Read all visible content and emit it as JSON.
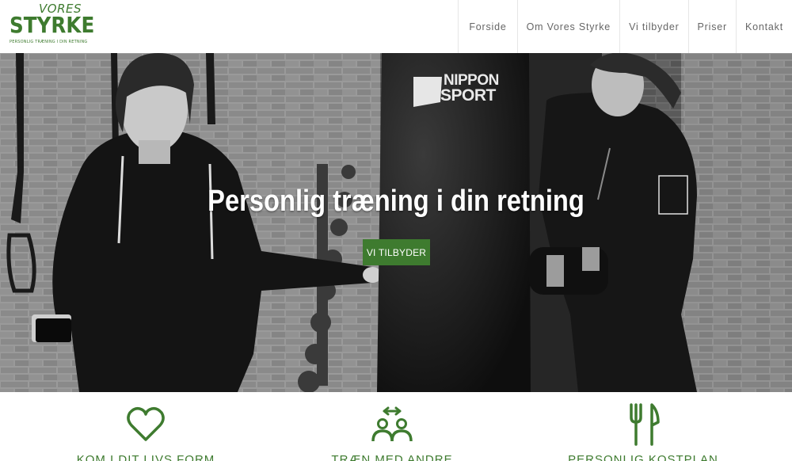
{
  "logo": {
    "line1": "VORES",
    "line2": "STYRKE",
    "tagline": "PERSONLIG TRÆNING I DIN RETNING"
  },
  "nav": {
    "items": [
      {
        "label": "Forside"
      },
      {
        "label": "Om Vores Styrke"
      },
      {
        "label": "Vi tilbyder"
      },
      {
        "label": "Priser"
      },
      {
        "label": "Kontakt"
      }
    ]
  },
  "hero": {
    "title": "Personlig træning i din retning",
    "button_label": "VI TILBYDER",
    "bag_brand_line1": "NIPPON",
    "bag_brand_line2": "SPORT"
  },
  "features": [
    {
      "title": "KOM I DIT LIVS FORM",
      "icon": "heart-icon"
    },
    {
      "title": "TRÆN MED ANDRE",
      "icon": "people-icon"
    },
    {
      "title": "PERSONLIG KOSTPLAN",
      "icon": "fork-knife-icon"
    }
  ],
  "colors": {
    "brand_green": "#3e7b2f",
    "nav_text": "#666666"
  }
}
